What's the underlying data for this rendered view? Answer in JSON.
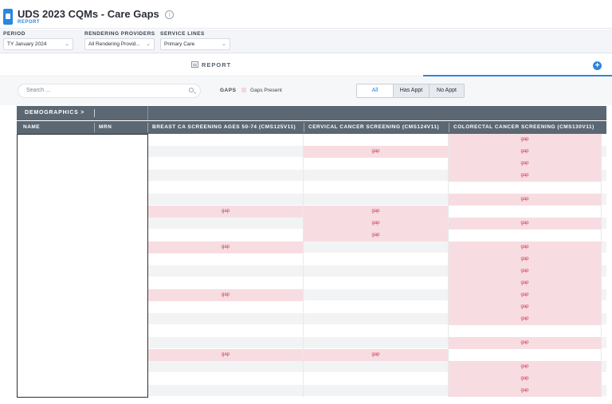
{
  "header": {
    "title": "UDS 2023 CQMs - Care Gaps",
    "subtitle": "REPORT",
    "info_glyph": "i"
  },
  "filters": {
    "period": {
      "label": "PERIOD",
      "value": "TY January 2024"
    },
    "providers": {
      "label": "RENDERING PROVIDERS",
      "value": "All Rendering Provid..."
    },
    "service": {
      "label": "SERVICE LINES",
      "value": "Primary Care"
    }
  },
  "report_bar": {
    "tab_label": "REPORT",
    "add_symbol": "+"
  },
  "toolbar": {
    "search_placeholder": "Search ...",
    "gaps_label": "GAPS",
    "gaps_legend_text": "Gaps Present",
    "filter_all": "All",
    "filter_has": "Has Appt",
    "filter_no": "No Appt"
  },
  "table": {
    "group_header": "DEMOGRAPHICS  >",
    "col_name": "NAME",
    "col_mrn": "MRN",
    "col_breast": "BREAST CA SCREENING AGES 50-74 (CMS125V11)",
    "col_cervical": "CERVICAL CANCER SCREENING (CMS124V11)",
    "col_colorectal": "COLORECTAL CANCER SCREENING (CMS130V11)",
    "gap_text": "gap",
    "rows": [
      [
        false,
        false,
        true
      ],
      [
        false,
        true,
        true
      ],
      [
        false,
        false,
        true
      ],
      [
        false,
        false,
        true
      ],
      [
        false,
        false,
        false
      ],
      [
        false,
        false,
        true
      ],
      [
        true,
        true,
        false
      ],
      [
        false,
        true,
        true
      ],
      [
        false,
        true,
        false
      ],
      [
        true,
        false,
        true
      ],
      [
        false,
        false,
        true
      ],
      [
        false,
        false,
        true
      ],
      [
        false,
        false,
        true
      ],
      [
        true,
        false,
        true
      ],
      [
        false,
        false,
        true
      ],
      [
        false,
        false,
        true
      ],
      [
        false,
        false,
        false
      ],
      [
        false,
        false,
        true
      ],
      [
        true,
        true,
        false
      ],
      [
        false,
        false,
        true
      ],
      [
        false,
        false,
        true
      ],
      [
        false,
        false,
        true
      ]
    ]
  },
  "colors": {
    "accent": "#2e86de",
    "header_bg": "#5b6773",
    "gap_bg": "#f7dde2",
    "gap_text": "#c8374f"
  }
}
